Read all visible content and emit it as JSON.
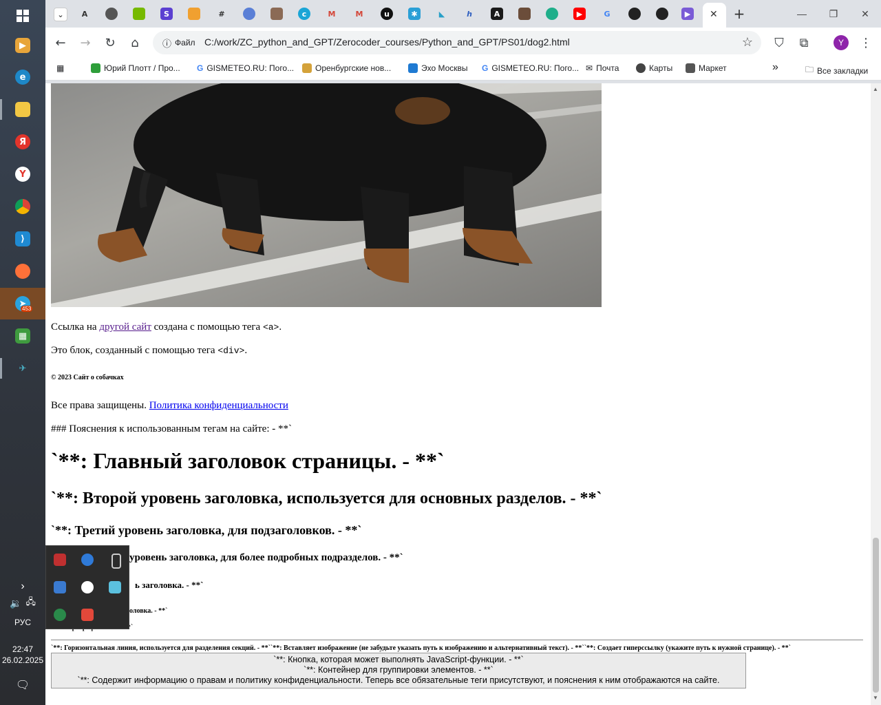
{
  "taskbar": {
    "clock_time": "22:47",
    "clock_date": "26.02.2025",
    "language": "РУС",
    "telegram_badge": "453"
  },
  "tabs": {
    "first_tab_label": "А"
  },
  "toolbar": {
    "file_chip": "Файл",
    "url": "C:/work/ZC_python_and_GPT/Zerocoder_courses/Python_and_GPT/PS01/dog2.html",
    "avatar_letter": "Y"
  },
  "bookmarks": {
    "items": [
      "Юрий Плотт / Про...",
      "GISMETEO.RU: Пого...",
      "Оренбургские нов...",
      "Эхо Москвы",
      "GISMETEO.RU: Пого...",
      "Почта",
      "Карты",
      "Маркет"
    ],
    "all_bookmarks": "Все закладки"
  },
  "page": {
    "link_line_pre": "Ссылка на ",
    "link_text": "другой сайт",
    "link_line_mid": " создана с помощью тега ",
    "link_line_code": "<a>",
    "link_line_end": ".",
    "div_line_pre": "Это блок, созданный с помощью тега ",
    "div_line_code": "<div>",
    "div_line_end": ".",
    "footer_heading": "© 2023 Сайт о собачках",
    "rights_text": "Все права защищены. ",
    "privacy_link": "Политика конфиденциальности",
    "explain_line": "### Пояснения к использованным тегам на сайте: - **`",
    "h1": "`**: Главный заголовок страницы. - **`",
    "h2": "`**: Второй уровень заголовка, используется для основных разделов. - **`",
    "h3": "`**: Третий уровень заголовка, для подзаголовков. - **`",
    "h4_visible": "уровень заголовка, для более подробных подразделов. - **`",
    "h5_visible": "ь заголовка. - **`",
    "h6_visible": "оловка. - **`",
    "p_visible": "**: Параграф текста. - **`",
    "hr_line": "`**: Горизонтальная линия, используется для разделения секций. - **``**: Вставляет изображение (не забудьте указать путь к изображению и альтернативный текст). - **``**: Создает гиперссылку (укажите путь к нужной странице). - **`",
    "box_lines": [
      "`**: Кнопка, которая может выполнять JavaScript-функции. - **`",
      "`**: Контейнер для группировки элементов. - **`",
      "`**: Содержит информацию о правам и политику конфиденциальности. Теперь все обязательные теги присутствуют, и пояснения к ним отображаются на сайте."
    ]
  }
}
